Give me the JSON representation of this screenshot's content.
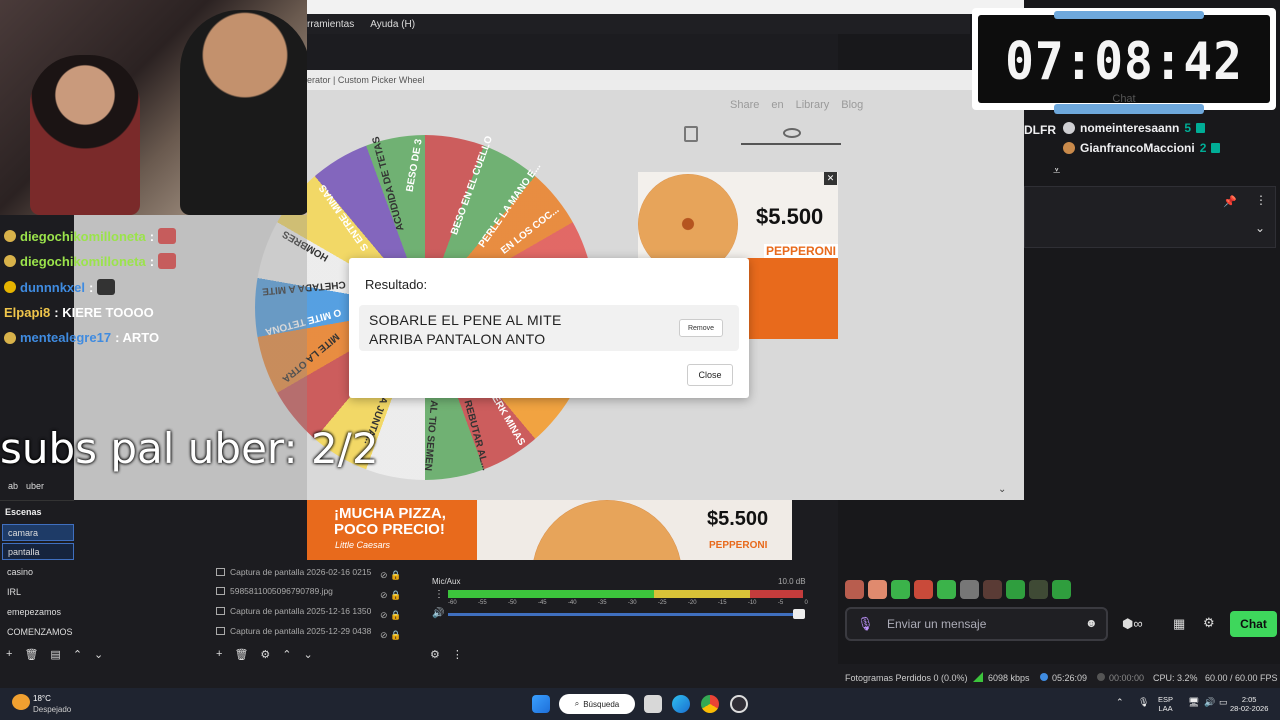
{
  "obs_menu": {
    "items": [
      "rramientas",
      "Ayuda (H)"
    ]
  },
  "browser": {
    "title": "erator | Custom Picker Wheel",
    "nav": [
      "Share",
      "en",
      "Library",
      "Blog"
    ]
  },
  "wheel": {
    "labels": [
      "BESO DE 3",
      "BESO EN EL CUELLO",
      "PERLE LA MANO E...",
      "EN LOS COC...",
      "ACUDIDA DE TETAS",
      "S ENTRE MINAS",
      "HOMBRES",
      "CHETADA A MITE",
      "O MITE TETONA",
      "MITE LA OTRA",
      "A JUNTA...",
      "AL TIO SEMEN",
      "REBUTAR AL...",
      "ERK MINAS"
    ]
  },
  "ads": {
    "top_price": "$5.500",
    "top_brand": "PEPPERONI",
    "bottom_title": "¡MUCHA PIZZA, POCO PRECIO!",
    "bottom_brand": "Little Caesars",
    "bottom_price": "$5.500",
    "bottom_pep": "PEPPERONI"
  },
  "modal": {
    "title": "Resultado:",
    "result_line1": "SOBARLE EL PENE AL MITE",
    "result_line2": "ARRIBA PANTALON ANTO",
    "remove_label": "Remove",
    "close_label": "Close"
  },
  "overlay_chat": [
    {
      "user": "diegochikomilloneta",
      "color": "green",
      "text": ":"
    },
    {
      "user": "diegochikomilloneta",
      "color": "green",
      "text": ":"
    },
    {
      "user": "dunnnkxel",
      "color": "blue",
      "text": ":"
    },
    {
      "user": "Elpapi8",
      "color": "yellow",
      "text": ": KIERE TOOOO"
    },
    {
      "user": "mentealegre17",
      "color": "blue",
      "text": ": ARTO"
    }
  ],
  "subs_text": "subs pal uber: 2/2",
  "obs": {
    "source_label": "uber",
    "scenes_title": "Escenas",
    "scenes": [
      "camara",
      "pantalla",
      "casino",
      "IRL",
      "emepezamos",
      "COMENZAMOS"
    ],
    "sources": [
      "Captura de pantalla 2026-02-16 0215",
      "5985811005096790789.jpg",
      "Captura de pantalla 2025-12-16 1350",
      "Captura de pantalla 2025-12-29 0438"
    ],
    "mixer_name": "Mic/Aux",
    "mixer_db": "10.0 dB",
    "mixer_scale": [
      "-60",
      "-55",
      "-50",
      "-45",
      "-40",
      "-35",
      "-30",
      "-25",
      "-20",
      "-15",
      "-10",
      "-5",
      "0"
    ]
  },
  "timer": {
    "value": "07:08:42",
    "caption": "Chat"
  },
  "leaderboard": [
    {
      "name": "nomeinteresaann",
      "count": "5"
    },
    {
      "name": "GianfrancoMaccioni",
      "count": "2"
    }
  ],
  "dlfr": "DLFR",
  "chat_input": {
    "placeholder": "Enviar un mensaje",
    "button": "Chat"
  },
  "status": {
    "frames_lost": "Fotogramas Perdidos 0 (0.0%)",
    "bitrate": "6098 kbps",
    "stream_time": "05:26:09",
    "rec_time": "00:00:00",
    "cpu": "CPU: 3.2%",
    "fps": "60.00 / 60.00 FPS"
  },
  "taskbar": {
    "temp": "18°C",
    "weather": "Despejado",
    "search": "Búsqueda",
    "lang1": "ESP",
    "lang2": "LAA",
    "time": "2:05",
    "date": "28-02-2026"
  }
}
